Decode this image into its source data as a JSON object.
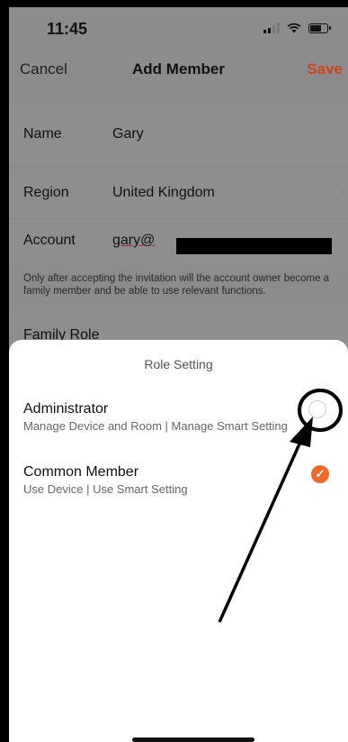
{
  "status_bar": {
    "time": "11:45"
  },
  "nav": {
    "cancel_label": "Cancel",
    "title": "Add Member",
    "save_label": "Save"
  },
  "form": {
    "name_label": "Name",
    "name_value": "Gary",
    "region_label": "Region",
    "region_value": "United Kingdom",
    "account_label": "Account",
    "account_value": "gary@",
    "hint": "Only after accepting the invitation will the account owner become a family member and be able to use relevant functions.",
    "family_role_partial": "Family Role"
  },
  "sheet": {
    "title": "Role Setting",
    "options": [
      {
        "title": "Administrator",
        "subtitle": "Manage Device and Room | Manage Smart Setting",
        "selected": false
      },
      {
        "title": "Common Member",
        "subtitle": "Use Device | Use Smart Setting",
        "selected": true
      }
    ]
  },
  "colors": {
    "accent": "#ec6a2a",
    "save": "#c8441c",
    "overlay": "#8c8c8c"
  },
  "icons": {
    "chevron": "chevron-right-icon",
    "check": "checkmark-icon",
    "arrow": "annotation-arrow"
  }
}
